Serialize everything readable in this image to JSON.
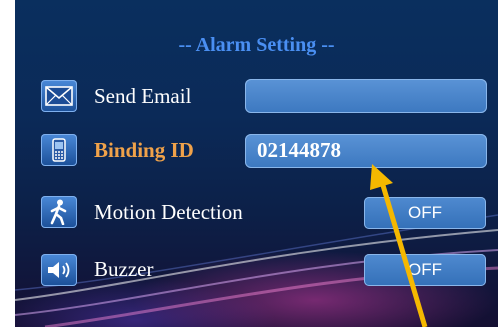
{
  "title": "-- Alarm Setting --",
  "rows": [
    {
      "label": "Send Email",
      "icon": "envelope-icon",
      "value": ""
    },
    {
      "label": "Binding ID",
      "icon": "phone-icon",
      "value": "02144878"
    },
    {
      "label": "Motion Detection",
      "icon": "walking-person-icon",
      "toggle": "OFF"
    },
    {
      "label": "Buzzer",
      "icon": "speaker-icon",
      "toggle": "OFF"
    }
  ],
  "colors": {
    "title": "#4a8ff2",
    "highlight_label": "#f0a24a",
    "annotation_arrow": "#f5b800"
  }
}
